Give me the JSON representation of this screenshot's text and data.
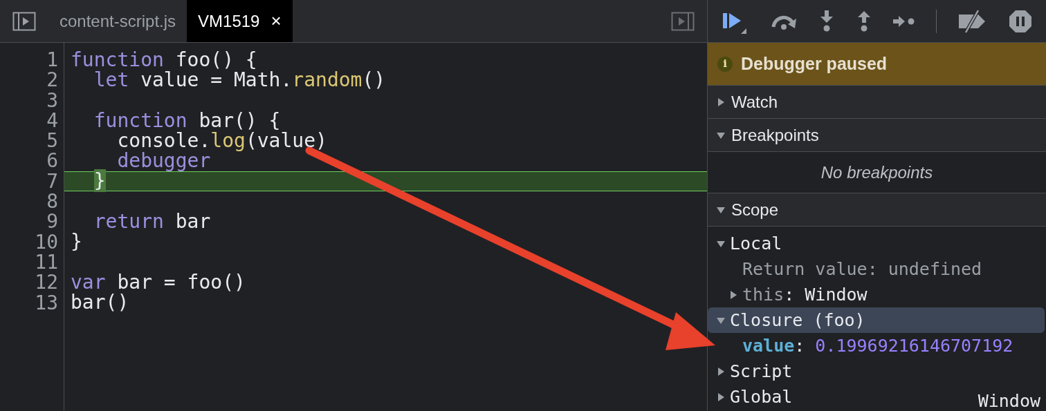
{
  "editor": {
    "tabs": [
      {
        "label": "content-script.js",
        "selected": false
      },
      {
        "label": "VM1519",
        "selected": true,
        "close": "×"
      }
    ],
    "lines": [
      {
        "number": "1",
        "paused": false,
        "tokens": [
          {
            "kind": "keyword",
            "text": "function"
          },
          {
            "kind": "plain",
            "text": " foo() {"
          }
        ]
      },
      {
        "number": "2",
        "paused": false,
        "tokens": [
          {
            "kind": "keyword",
            "text": "  let"
          },
          {
            "kind": "plain",
            "text": " value = Math."
          },
          {
            "kind": "method",
            "text": "random"
          },
          {
            "kind": "plain",
            "text": "()"
          }
        ]
      },
      {
        "number": "3",
        "paused": false
      },
      {
        "number": "4",
        "paused": false,
        "tokens": [
          {
            "kind": "keyword",
            "text": "  function"
          },
          {
            "kind": "plain",
            "text": " bar() {"
          }
        ]
      },
      {
        "number": "5",
        "paused": false,
        "tokens": [
          {
            "kind": "plain",
            "text": "    console."
          },
          {
            "kind": "method",
            "text": "log"
          },
          {
            "kind": "plain",
            "text": "(value)"
          }
        ]
      },
      {
        "number": "6",
        "paused": false,
        "tokens": [
          {
            "kind": "keyword",
            "text": "    debugger"
          }
        ]
      },
      {
        "number": "7",
        "paused": true,
        "tokens": [
          {
            "kind": "current",
            "text": "  }"
          }
        ]
      },
      {
        "number": "8",
        "paused": false
      },
      {
        "number": "9",
        "paused": false,
        "tokens": [
          {
            "kind": "keyword",
            "text": "  return"
          },
          {
            "kind": "plain",
            "text": " bar"
          }
        ]
      },
      {
        "number": "10",
        "paused": false,
        "tokens": [
          {
            "kind": "plain",
            "text": "}"
          }
        ]
      },
      {
        "number": "11",
        "paused": false
      },
      {
        "number": "12",
        "paused": false,
        "tokens": [
          {
            "kind": "keyword",
            "text": "var"
          },
          {
            "kind": "plain",
            "text": " bar = foo()"
          }
        ]
      },
      {
        "number": "13",
        "paused": false,
        "tokens": [
          {
            "kind": "plain",
            "text": "bar()"
          }
        ]
      }
    ]
  },
  "debugger": {
    "banner": {
      "icon": "i",
      "text": "Debugger paused"
    },
    "sections": [
      {
        "title": "Watch",
        "expanded": false
      },
      {
        "title": "Breakpoints",
        "expanded": true,
        "empty_message": "No breakpoints"
      },
      {
        "title": "Scope",
        "expanded": true
      }
    ],
    "scope": [
      {
        "label": "Local",
        "expanded": true,
        "selected": false,
        "children": [
          {
            "kind": "synthetic",
            "name": "Return value:",
            "value": "undefined"
          },
          {
            "kind": "object",
            "name": "this:",
            "value": "Window",
            "expanded": false
          }
        ]
      },
      {
        "label": "Closure (foo)",
        "expanded": true,
        "selected": true,
        "children": [
          {
            "kind": "variable",
            "name": "value:",
            "value": "0.19969216146707192"
          }
        ]
      },
      {
        "label": "Script",
        "expanded": false,
        "selected": false
      },
      {
        "label": "Global",
        "expanded": false,
        "selected": false,
        "value": "Window"
      }
    ]
  }
}
